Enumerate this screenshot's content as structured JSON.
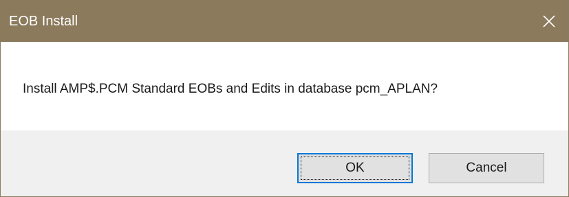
{
  "window": {
    "title": "EOB Install",
    "close_icon": "close-icon"
  },
  "dialog": {
    "message": "Install AMP$.PCM Standard EOBs and Edits in database pcm_APLAN?"
  },
  "buttons": {
    "ok_label": "OK",
    "cancel_label": "Cancel"
  },
  "colors": {
    "titlebar": "#8b7a5c",
    "footer": "#f0f0f0",
    "focus_border": "#0078d7"
  }
}
